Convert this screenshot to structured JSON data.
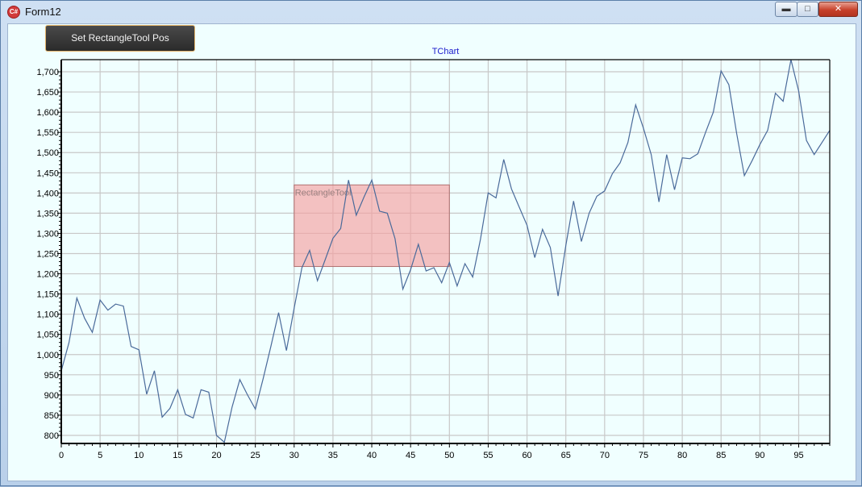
{
  "window": {
    "title": "Form12",
    "icon": "app-icon",
    "controls": [
      "minimize-icon",
      "maximize-icon",
      "close-icon"
    ]
  },
  "toolbar": {
    "set_pos_label": "Set RectangleTool Pos"
  },
  "chart_data": {
    "type": "line",
    "title": "TChart",
    "xlabel": "",
    "ylabel": "",
    "xlim": [
      0,
      99
    ],
    "ylim": [
      780,
      1730
    ],
    "xticks": [
      0,
      5,
      10,
      15,
      20,
      25,
      30,
      35,
      40,
      45,
      50,
      55,
      60,
      65,
      70,
      75,
      80,
      85,
      90,
      95
    ],
    "yticks": [
      800,
      850,
      900,
      950,
      1000,
      1050,
      1100,
      1150,
      1200,
      1250,
      1300,
      1350,
      1400,
      1450,
      1500,
      1550,
      1600,
      1650,
      1700
    ],
    "ytick_labels": [
      "800",
      "850",
      "900",
      "950",
      "1,000",
      "1,050",
      "1,100",
      "1,150",
      "1,200",
      "1,250",
      "1,300",
      "1,350",
      "1,400",
      "1,450",
      "1,500",
      "1,550",
      "1,600",
      "1,650",
      "1,700"
    ],
    "grid": true,
    "line_color": "#4a6a9a",
    "series": [
      {
        "x": [
          0,
          1,
          2,
          3,
          4,
          5,
          6,
          7,
          8,
          9,
          10,
          11,
          12,
          13,
          14,
          15,
          16,
          17,
          18,
          19,
          20,
          21,
          22,
          23,
          24,
          25,
          26,
          27,
          28,
          29,
          30,
          31,
          32,
          33,
          34,
          35,
          36,
          37,
          38,
          39,
          40,
          41,
          42,
          43,
          44,
          45,
          46,
          47,
          48,
          49,
          50,
          51,
          52,
          53,
          54,
          55,
          56,
          57,
          58,
          59,
          60,
          61,
          62,
          63,
          64,
          65,
          66,
          67,
          68,
          69,
          70,
          71,
          72,
          73,
          74,
          75,
          76,
          77,
          78,
          79,
          80,
          81,
          82,
          83,
          84,
          85,
          86,
          87,
          88,
          89,
          90,
          91,
          92,
          93,
          94,
          95,
          96,
          97,
          98,
          99
        ],
        "values": [
          960,
          1030,
          1140,
          1090,
          1055,
          1135,
          1110,
          1125,
          1120,
          1020,
          1012,
          902,
          960,
          845,
          867,
          913,
          852,
          843,
          913,
          907,
          800,
          783,
          870,
          938,
          900,
          865,
          940,
          1020,
          1104,
          1010,
          1115,
          1215,
          1258,
          1183,
          1235,
          1288,
          1312,
          1432,
          1345,
          1390,
          1432,
          1355,
          1350,
          1287,
          1162,
          1210,
          1273,
          1207,
          1215,
          1178,
          1228,
          1170,
          1225,
          1192,
          1285,
          1400,
          1388,
          1483,
          1410,
          1365,
          1320,
          1240,
          1310,
          1265,
          1145,
          1270,
          1380,
          1280,
          1350,
          1392,
          1405,
          1448,
          1475,
          1525,
          1618,
          1560,
          1495,
          1378,
          1495,
          1408,
          1487,
          1485,
          1497,
          1550,
          1600,
          1702,
          1668,
          1548,
          1443,
          1480,
          1520,
          1555,
          1647,
          1627,
          1730,
          1652,
          1530,
          1495,
          1525,
          1555
        ]
      }
    ],
    "annotations": [
      {
        "type": "rectangle",
        "label": "RectangleTool",
        "x": [
          30,
          50
        ],
        "y": [
          1218,
          1420
        ],
        "color": "#f4a0a0"
      }
    ]
  }
}
